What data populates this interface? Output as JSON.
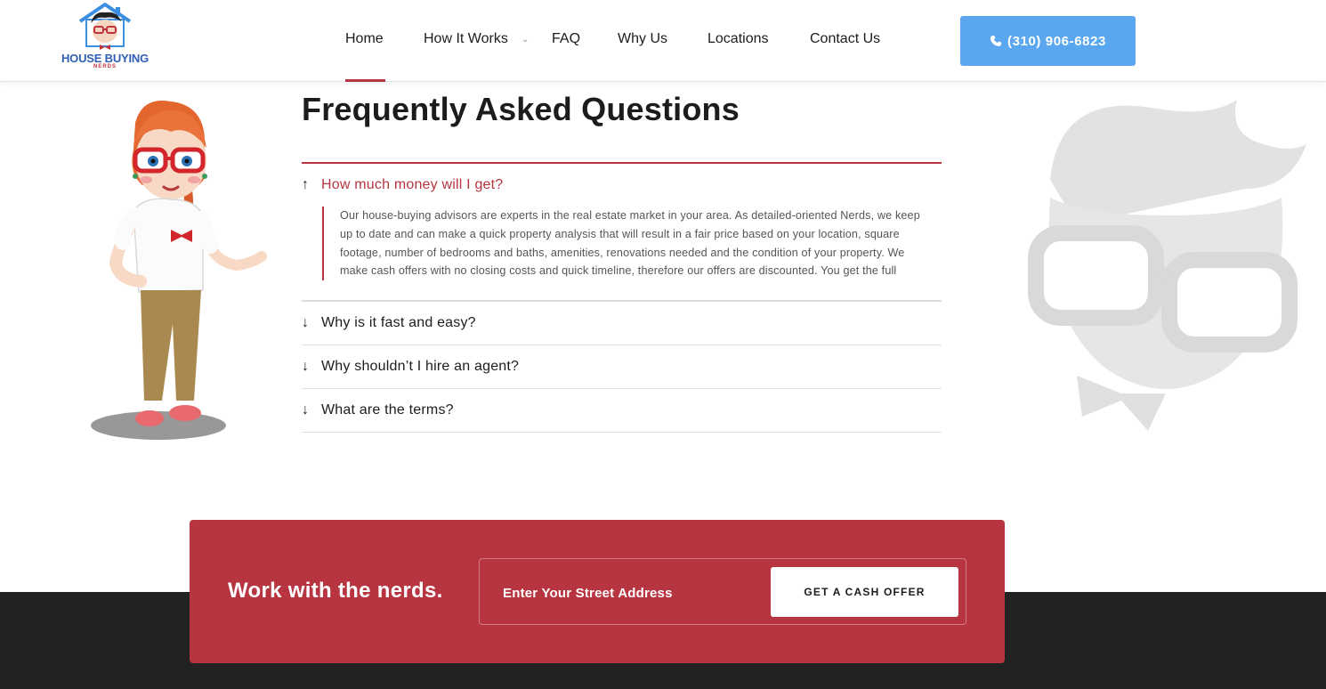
{
  "header": {
    "logo": {
      "text": "HOUSE BUYING",
      "sub": "NERDS",
      "icon": "house-nerd-logo"
    },
    "nav": [
      {
        "label": "Home",
        "active": true
      },
      {
        "label": "How It Works",
        "has_dropdown": true
      },
      {
        "label": "FAQ"
      },
      {
        "label": "Why Us"
      },
      {
        "label": "Locations"
      },
      {
        "label": "Contact Us"
      }
    ],
    "phone": {
      "label": "(310) 906-6823",
      "icon": "phone-icon"
    }
  },
  "faq": {
    "title": "Frequently Asked Questions",
    "items": [
      {
        "question": "How much money will I get?",
        "open": true,
        "icon": "arrow-up-icon",
        "answer": "Our house-buying advisors are experts in the real estate market in your area. As detailed-oriented Nerds, we keep up to date and can make a quick property analysis that will result in a fair price based on your location, square footage, number of bedrooms and baths, amenities, renovations needed and the condition of your property. We make cash offers with no closing costs and quick timeline, therefore our offers are discounted. You get the full"
      },
      {
        "question": "Why is it fast and easy?",
        "open": false,
        "icon": "arrow-down-icon"
      },
      {
        "question": "Why shouldn’t I hire an agent?",
        "open": false,
        "icon": "arrow-down-icon"
      },
      {
        "question": "What are the terms?",
        "open": false,
        "icon": "arrow-down-icon"
      }
    ]
  },
  "cta": {
    "title": "Work with the nerds.",
    "input_placeholder": "Enter Your Street Address",
    "button_label": "GET A CASH OFFER"
  },
  "colors": {
    "accent": "#b73540",
    "phone_button": "#5aa7f0",
    "footer_dark": "#222222"
  }
}
